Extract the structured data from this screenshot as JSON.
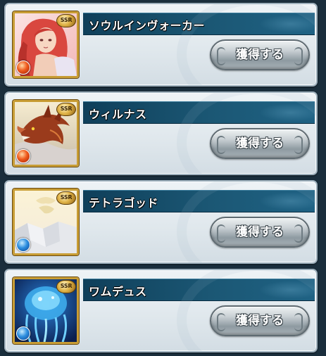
{
  "items": [
    {
      "name": "ソウルインヴォーカー",
      "rarity": "SSR",
      "element": "fire",
      "button_label": "獲得する"
    },
    {
      "name": "ウィルナス",
      "rarity": "SSR",
      "element": "fire",
      "button_label": "獲得する"
    },
    {
      "name": "テトラゴッド",
      "rarity": "SSR",
      "element": "water",
      "button_label": "獲得する"
    },
    {
      "name": "ワムデュス",
      "rarity": "SSR",
      "element": "water",
      "button_label": "獲得する"
    }
  ],
  "colors": {
    "fire": "#f05a1c",
    "water": "#2d8fe0",
    "title_bar": "#1b5774",
    "frame_gold": "#c89d35"
  }
}
